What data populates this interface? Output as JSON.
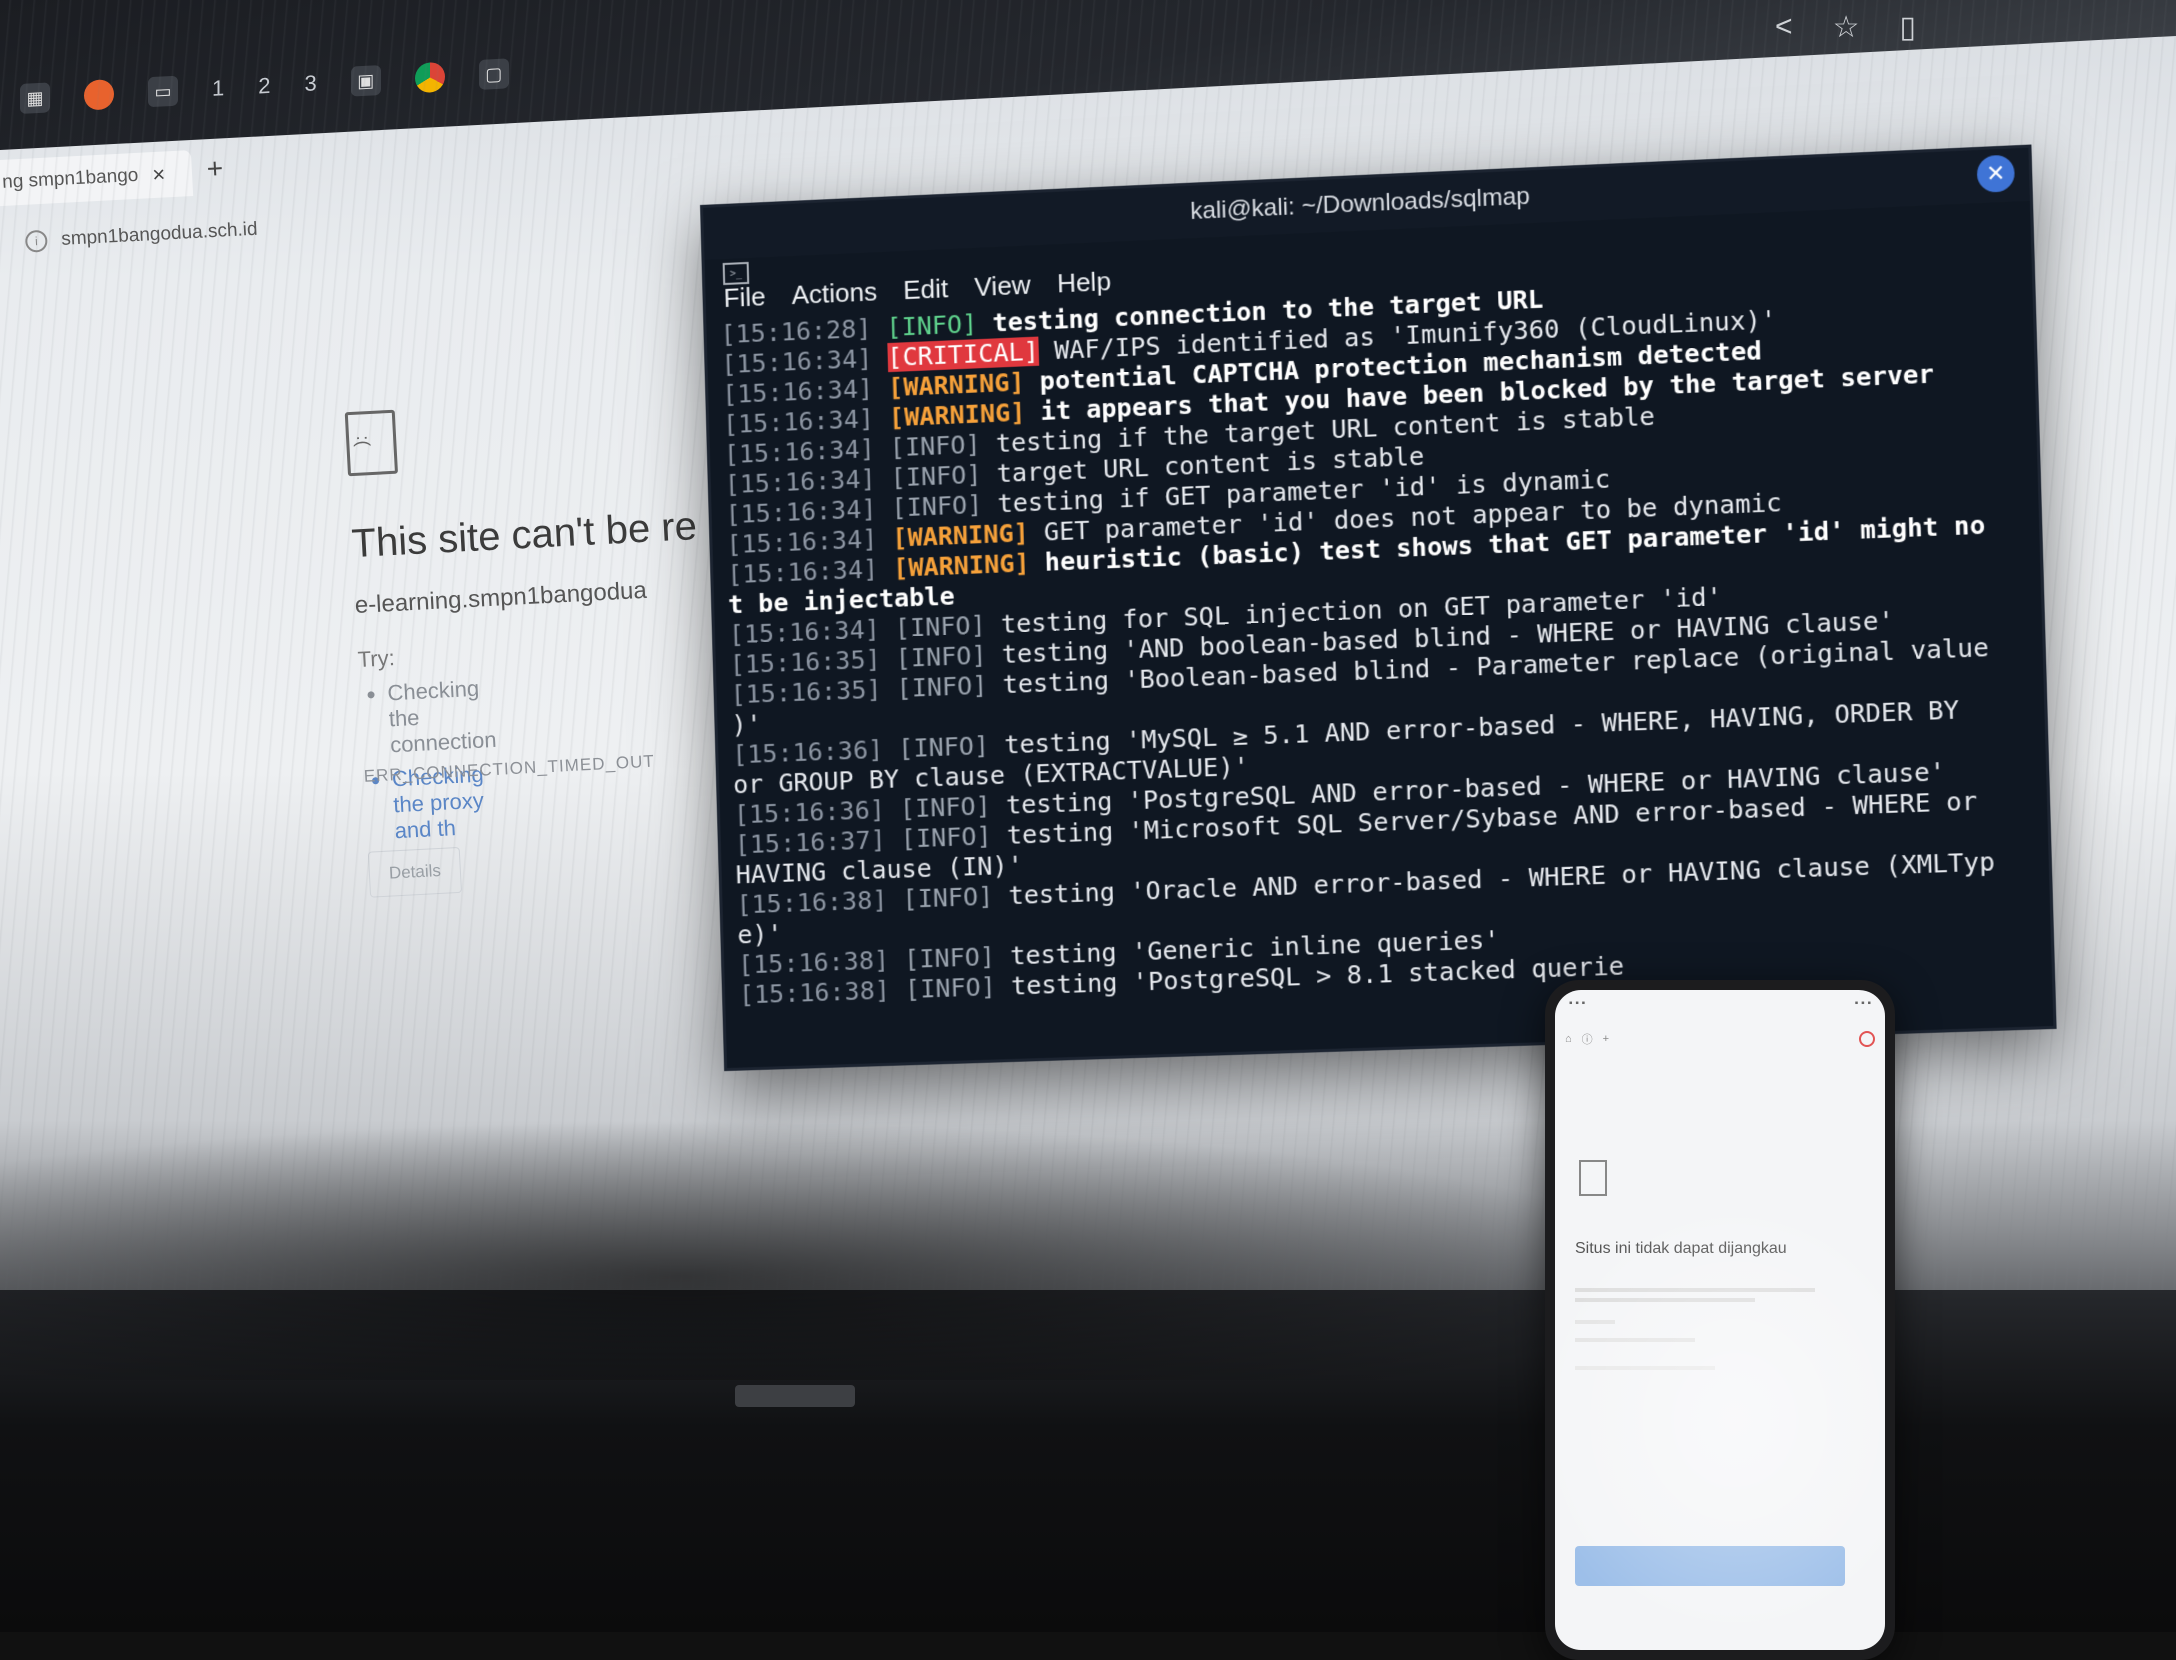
{
  "taskbar": {
    "workspaces": [
      "1",
      "2",
      "3"
    ]
  },
  "browser": {
    "tab_title": "ng smpn1bango",
    "tab_close": "×",
    "new_tab": "+",
    "address": "smpn1bangodua.sch.id",
    "error": {
      "title": "This site can't be re",
      "host": "e-learning.smpn1bangodua",
      "try_label": "Try:",
      "suggestions": [
        "Checking the connection",
        "Checking the proxy and th"
      ],
      "code": "ERR_CONNECTION_TIMED_OUT",
      "details_button": "Details"
    }
  },
  "terminal": {
    "title": "kali@kali: ~/Downloads/sqlmap",
    "menu": [
      "File",
      "Actions",
      "Edit",
      "View",
      "Help"
    ],
    "lines": [
      {
        "ts": "[15:16:28]",
        "tag": "[INFO]",
        "level": "info",
        "text": " testing connection to the target URL",
        "bold": true
      },
      {
        "ts": "[15:16:34]",
        "tag": "[CRITICAL]",
        "level": "critical",
        "text": " WAF/IPS identified as 'Imunify360 (CloudLinux)'"
      },
      {
        "ts": "[15:16:34]",
        "tag": "[WARNING]",
        "level": "warning",
        "text": " potential CAPTCHA protection mechanism detected",
        "bold": true
      },
      {
        "ts": "[15:16:34]",
        "tag": "[WARNING]",
        "level": "warning",
        "text": " it appears that you have been blocked by the target server",
        "bold": true
      },
      {
        "ts": "[15:16:34]",
        "tag": "[INFO]",
        "level": "info-dim",
        "text": " testing if the target URL content is stable"
      },
      {
        "ts": "[15:16:34]",
        "tag": "[INFO]",
        "level": "info-dim",
        "text": " target URL content is stable"
      },
      {
        "ts": "[15:16:34]",
        "tag": "[INFO]",
        "level": "info-dim",
        "text": " testing if GET parameter 'id' is dynamic"
      },
      {
        "ts": "[15:16:34]",
        "tag": "[WARNING]",
        "level": "warning",
        "text": " GET parameter 'id' does not appear to be dynamic"
      },
      {
        "ts": "[15:16:34]",
        "tag": "[WARNING]",
        "level": "warning",
        "text": " heuristic (basic) test shows that GET parameter 'id' might no",
        "bold": true
      },
      {
        "ts": "",
        "tag": "",
        "level": "none",
        "text": "t be injectable",
        "bold": true
      },
      {
        "ts": "[15:16:34]",
        "tag": "[INFO]",
        "level": "info-dim",
        "text": " testing for SQL injection on GET parameter 'id'"
      },
      {
        "ts": "[15:16:35]",
        "tag": "[INFO]",
        "level": "info-dim",
        "text": " testing 'AND boolean-based blind - WHERE or HAVING clause'"
      },
      {
        "ts": "[15:16:35]",
        "tag": "[INFO]",
        "level": "info-dim",
        "text": " testing 'Boolean-based blind - Parameter replace (original value"
      },
      {
        "ts": "",
        "tag": "",
        "level": "none",
        "text": ")'"
      },
      {
        "ts": "[15:16:36]",
        "tag": "[INFO]",
        "level": "info-dim",
        "text": " testing 'MySQL ≥ 5.1 AND error-based - WHERE, HAVING, ORDER BY"
      },
      {
        "ts": "",
        "tag": "",
        "level": "none",
        "text": "or GROUP BY clause (EXTRACTVALUE)'"
      },
      {
        "ts": "[15:16:36]",
        "tag": "[INFO]",
        "level": "info-dim",
        "text": " testing 'PostgreSQL AND error-based - WHERE or HAVING clause'"
      },
      {
        "ts": "[15:16:37]",
        "tag": "[INFO]",
        "level": "info-dim",
        "text": " testing 'Microsoft SQL Server/Sybase AND error-based - WHERE or"
      },
      {
        "ts": "",
        "tag": "",
        "level": "none",
        "text": "HAVING clause (IN)'"
      },
      {
        "ts": "[15:16:38]",
        "tag": "[INFO]",
        "level": "info-dim",
        "text": " testing 'Oracle AND error-based - WHERE or HAVING clause (XMLTyp"
      },
      {
        "ts": "",
        "tag": "",
        "level": "none",
        "text": "e)'"
      },
      {
        "ts": "[15:16:38]",
        "tag": "[INFO]",
        "level": "info-dim",
        "text": " testing 'Generic inline queries'"
      },
      {
        "ts": "[15:16:38]",
        "tag": "[INFO]",
        "level": "info-dim",
        "text": " testing 'PostgreSQL > 8.1 stacked querie"
      }
    ]
  },
  "phone": {
    "error_title": "Situs ini tidak dapat dijangkau",
    "plus": "+"
  },
  "colors": {
    "terminal_bg": "#0f1722",
    "info": "#5fd38d",
    "critical": "#e0383e",
    "warning": "#f6a13a",
    "close_button": "#3f74d6"
  },
  "icons": [
    "firefox-icon",
    "chrome-icon",
    "terminal-icon",
    "share-icon",
    "star-icon",
    "sad-document-icon",
    "info-icon",
    "close-icon"
  ]
}
